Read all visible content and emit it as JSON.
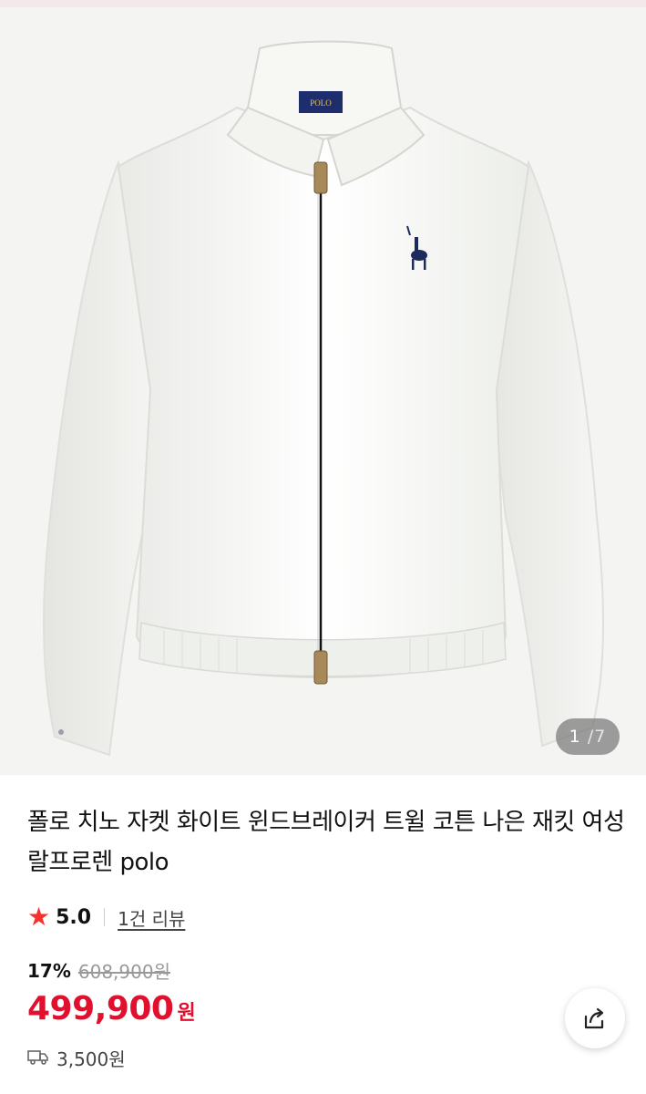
{
  "gallery": {
    "current": "1",
    "separator": "/",
    "total": "7",
    "logo_text": "POLO"
  },
  "product": {
    "title": "폴로 치노 자켓 화이트 윈드브레이커 트윌 코튼 나은 재킷 여성 랄프로렌 polo"
  },
  "rating": {
    "score": "5.0",
    "reviews_label": "1건 리뷰"
  },
  "pricing": {
    "discount": "17%",
    "original_price": "608,900원",
    "price": "499,900",
    "currency": "원",
    "accent_color": "#e0102e"
  },
  "shipping": {
    "fee": "3,500원",
    "icon": "truck-icon"
  },
  "icons": {
    "share": "share-icon",
    "rating": "star-icon"
  }
}
